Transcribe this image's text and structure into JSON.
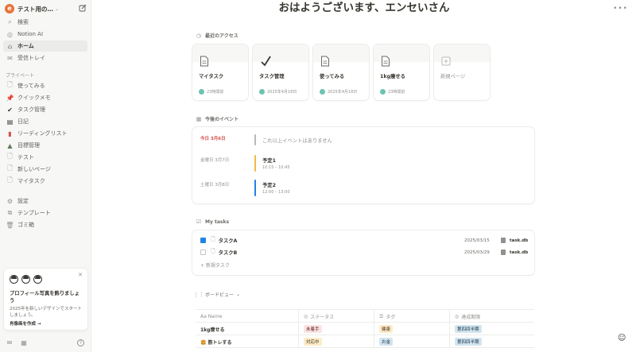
{
  "sidebar": {
    "workspace": "テスト用の…",
    "workspace_initial": "e",
    "nav": [
      {
        "label": "検索",
        "icon": "search-icon"
      },
      {
        "label": "Notion AI",
        "icon": "ai-icon"
      },
      {
        "label": "ホーム",
        "icon": "home-icon"
      },
      {
        "label": "受信トレイ",
        "icon": "inbox-icon"
      }
    ],
    "private_label": "プライベート",
    "pages": [
      {
        "label": "使ってみる",
        "icon": "page-icon"
      },
      {
        "label": "クイックメモ",
        "icon": "pin-icon"
      },
      {
        "label": "タスク管理",
        "icon": "check-icon"
      },
      {
        "label": "日記",
        "icon": "notebook-icon"
      },
      {
        "label": "リーディングリスト",
        "icon": "book-icon"
      },
      {
        "label": "目標管理",
        "icon": "mountain-icon"
      },
      {
        "label": "テスト",
        "icon": "page-icon"
      },
      {
        "label": "新しいページ",
        "icon": "page-icon"
      },
      {
        "label": "マイタスク",
        "icon": "page-icon"
      }
    ],
    "utilities": [
      {
        "label": "設定",
        "icon": "gear-icon"
      },
      {
        "label": "テンプレート",
        "icon": "template-icon"
      },
      {
        "label": "ゴミ箱",
        "icon": "trash-icon"
      }
    ],
    "promo": {
      "title": "プロフィール写真を飾りましょう",
      "text": "2025年を新しいデザインでスタートしましょう。",
      "link": "肖像画を作成 →"
    }
  },
  "main": {
    "greeting": "おはようございます、エンセいさん",
    "recent": {
      "heading": "最近のアクセス",
      "cards": [
        {
          "title": "マイタスク",
          "meta": "23時間前"
        },
        {
          "title": "タスク管理",
          "meta": "2025年4月18日"
        },
        {
          "title": "使ってみる",
          "meta": "2025年4月18日"
        },
        {
          "title": "1kg痩せる",
          "meta": "23時間前"
        },
        {
          "title": "新規ページ",
          "meta": ""
        }
      ]
    },
    "events": {
      "heading": "今後のイベント",
      "rows": [
        {
          "date": "今日 3月6日",
          "title": "これ以上イベントはありません",
          "time": "",
          "color": "#b9b8b5"
        },
        {
          "date": "金曜日 3月7日",
          "title": "予定1",
          "time": "10:15 – 10:45",
          "color": "#f0b94a"
        },
        {
          "date": "土曜日 3月8日",
          "title": "予定2",
          "time": "12:00 – 13:00",
          "color": "#2383e2"
        }
      ]
    },
    "tasks": {
      "heading": "My tasks",
      "rows": [
        {
          "name": "タスクA",
          "date": "2025/03/15",
          "db": "task.db",
          "checked": true
        },
        {
          "name": "タスクB",
          "date": "2025/03/29",
          "db": "task.db",
          "checked": false
        }
      ],
      "new_label": "+ 新規タスク"
    },
    "board": {
      "heading": "ボードビュー",
      "columns": [
        "Aa Name",
        "ステータス",
        "タグ",
        "達成期限"
      ],
      "rows": [
        {
          "name": "1kg痩せる",
          "status": "未着手",
          "tag": "健康",
          "deadline": "第四四半期"
        },
        {
          "name": "🍔 筋トレする",
          "status": "対応中",
          "tag": "お金",
          "deadline": "第四四半期"
        }
      ]
    }
  },
  "colors": {
    "accent": "#2383e2",
    "today_red": "#d44c47"
  }
}
